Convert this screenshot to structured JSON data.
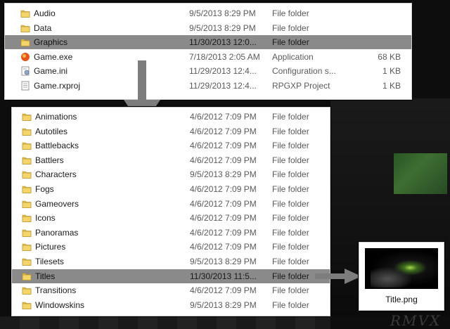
{
  "top_listing": {
    "rows": [
      {
        "icon": "folder-icon",
        "name": "Audio",
        "date": "9/5/2013 8:29 PM",
        "type": "File folder",
        "size": "",
        "selected": false
      },
      {
        "icon": "folder-icon",
        "name": "Data",
        "date": "9/5/2013 8:29 PM",
        "type": "File folder",
        "size": "",
        "selected": false
      },
      {
        "icon": "folder-icon",
        "name": "Graphics",
        "date": "11/30/2013 12:0...",
        "type": "File folder",
        "size": "",
        "selected": true
      },
      {
        "icon": "game-exe-icon",
        "name": "Game.exe",
        "date": "7/18/2013 2:05 AM",
        "type": "Application",
        "size": "68 KB",
        "selected": false
      },
      {
        "icon": "ini-file-icon",
        "name": "Game.ini",
        "date": "11/29/2013 12:4...",
        "type": "Configuration s...",
        "size": "1 KB",
        "selected": false
      },
      {
        "icon": "project-file-icon",
        "name": "Game.rxproj",
        "date": "11/29/2013 12:4...",
        "type": "RPGXP Project",
        "size": "1 KB",
        "selected": false
      }
    ]
  },
  "graphics_listing": {
    "rows": [
      {
        "name": "Animations",
        "date": "4/6/2012 7:09 PM",
        "type": "File folder",
        "selected": false
      },
      {
        "name": "Autotiles",
        "date": "4/6/2012 7:09 PM",
        "type": "File folder",
        "selected": false
      },
      {
        "name": "Battlebacks",
        "date": "4/6/2012 7:09 PM",
        "type": "File folder",
        "selected": false
      },
      {
        "name": "Battlers",
        "date": "4/6/2012 7:09 PM",
        "type": "File folder",
        "selected": false
      },
      {
        "name": "Characters",
        "date": "9/5/2013 8:29 PM",
        "type": "File folder",
        "selected": false
      },
      {
        "name": "Fogs",
        "date": "4/6/2012 7:09 PM",
        "type": "File folder",
        "selected": false
      },
      {
        "name": "Gameovers",
        "date": "4/6/2012 7:09 PM",
        "type": "File folder",
        "selected": false
      },
      {
        "name": "Icons",
        "date": "4/6/2012 7:09 PM",
        "type": "File folder",
        "selected": false
      },
      {
        "name": "Panoramas",
        "date": "4/6/2012 7:09 PM",
        "type": "File folder",
        "selected": false
      },
      {
        "name": "Pictures",
        "date": "4/6/2012 7:09 PM",
        "type": "File folder",
        "selected": false
      },
      {
        "name": "Tilesets",
        "date": "9/5/2013 8:29 PM",
        "type": "File folder",
        "selected": false
      },
      {
        "name": "Titles",
        "date": "11/30/2013 11:5...",
        "type": "File folder",
        "selected": true
      },
      {
        "name": "Transitions",
        "date": "4/6/2012 7:09 PM",
        "type": "File folder",
        "selected": false
      },
      {
        "name": "Windowskins",
        "date": "9/5/2013 8:29 PM",
        "type": "File folder",
        "selected": false
      }
    ]
  },
  "preview": {
    "file_name": "Title.png",
    "icon": "image-thumbnail"
  },
  "background": {
    "watermark": "RMVX"
  },
  "colors": {
    "selection": "#8a8a8a",
    "folder": "#e8c24a",
    "arrow": "#7d7d7d"
  }
}
